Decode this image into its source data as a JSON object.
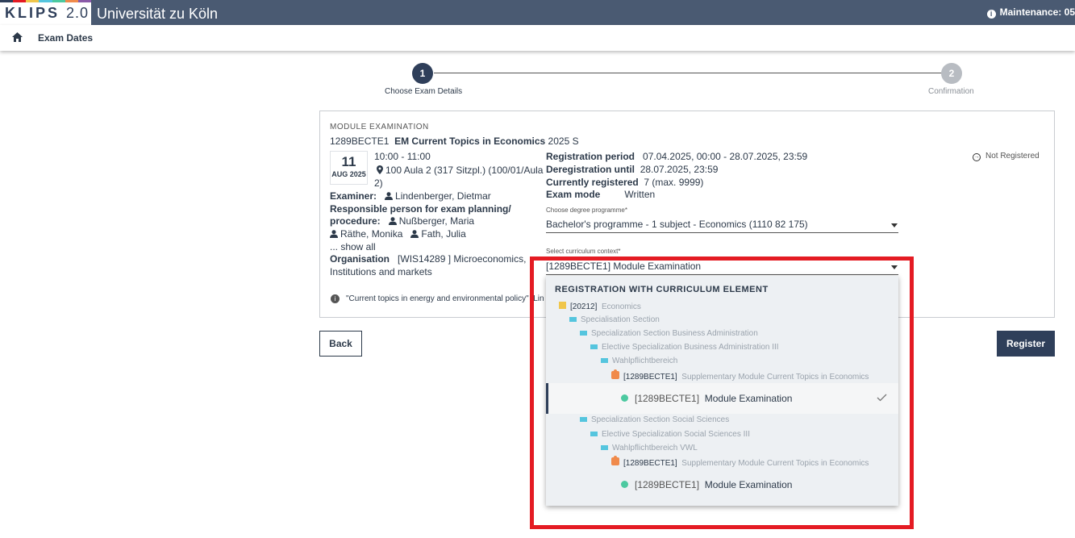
{
  "topbar": {
    "logo_main": "KLIPS",
    "logo_version": "2.0",
    "university": "Universität zu Köln",
    "maintenance": "Maintenance: 05",
    "stripe_colors": [
      "#2f3f5a",
      "#e41b23",
      "#f0c64b",
      "#55c5de",
      "#4cc9a0",
      "#f08a4b",
      "#8a5aa8"
    ]
  },
  "nav": {
    "home_icon": "home-icon",
    "exam_dates": "Exam Dates"
  },
  "stepper": {
    "steps": [
      {
        "number": "1",
        "label": "Choose Exam Details"
      },
      {
        "number": "2",
        "label": "Confirmation"
      }
    ]
  },
  "exam": {
    "type_label": "MODULE EXAMINATION",
    "code": "1289BECTE1",
    "title": "EM Current Topics in Economics",
    "semester": "2025 S",
    "date_day": "11",
    "date_month": "AUG 2025",
    "time": "10:00 - 11:00",
    "location_line1": "100 Aula 2 (317 Sitzpl.) (100/01/Aula",
    "location_line2": "2)",
    "examiner_label": "Examiner:",
    "examiner": "Lindenberger, Dietmar",
    "responsible_label_1": "Responsible person for exam planning/",
    "responsible_label_2": "procedure:",
    "responsible_1": "Nußberger, Maria",
    "responsible_2": "Räthe, Monika",
    "responsible_3": "Fath, Julia",
    "show_all": "... show all",
    "organisation_label": "Organisation",
    "organisation_line1": "[WIS14289 ] Microeconomics,",
    "organisation_line2": "Institutions and markets",
    "note": "\"Current topics in energy and environmental policy\" [Lin",
    "registration_period_label": "Registration period",
    "registration_period": "07.04.2025, 00:00 - 28.07.2025, 23:59",
    "deregistration_label": "Deregistration until",
    "deregistration": "28.07.2025, 23:59",
    "currently_registered_label": "Currently registered",
    "currently_registered": "7 (max. 9999)",
    "exam_mode_label": "Exam mode",
    "exam_mode": "Written",
    "status": "Not Registered",
    "degree_label": "Choose degree programme*",
    "degree_value": "Bachelor's programme - 1 subject - Economics (1110 82 175)",
    "curriculum_label": "Select curriculum context*",
    "curriculum_value": "[1289BECTE1]  Module Examination"
  },
  "buttons": {
    "back": "Back",
    "register": "Register"
  },
  "dropdown": {
    "header": "REGISTRATION WITH CURRICULUM ELEMENT",
    "group1": {
      "root_code": "[20212]",
      "root_name": "Economics",
      "l1": "Specialisation Section",
      "l2": "Specialization Section Business Administration",
      "l3": "Elective Specialization Business Administration III",
      "l4": "Wahlpflichtbereich",
      "module_code": "[1289BECTE1]",
      "module_name": "Supplementary Module Current Topics in Economics",
      "exam_code": "[1289BECTE1]",
      "exam_name": "Module Examination"
    },
    "group2": {
      "l2": "Specialization Section Social Sciences",
      "l3": "Elective Specialization Social Sciences III",
      "l4": "Wahlpflichtbereich VWL",
      "module_code": "[1289BECTE1]",
      "module_name": "Supplementary Module Current Topics in Economics",
      "exam_code": "[1289BECTE1]",
      "exam_name": "Module Examination"
    }
  }
}
